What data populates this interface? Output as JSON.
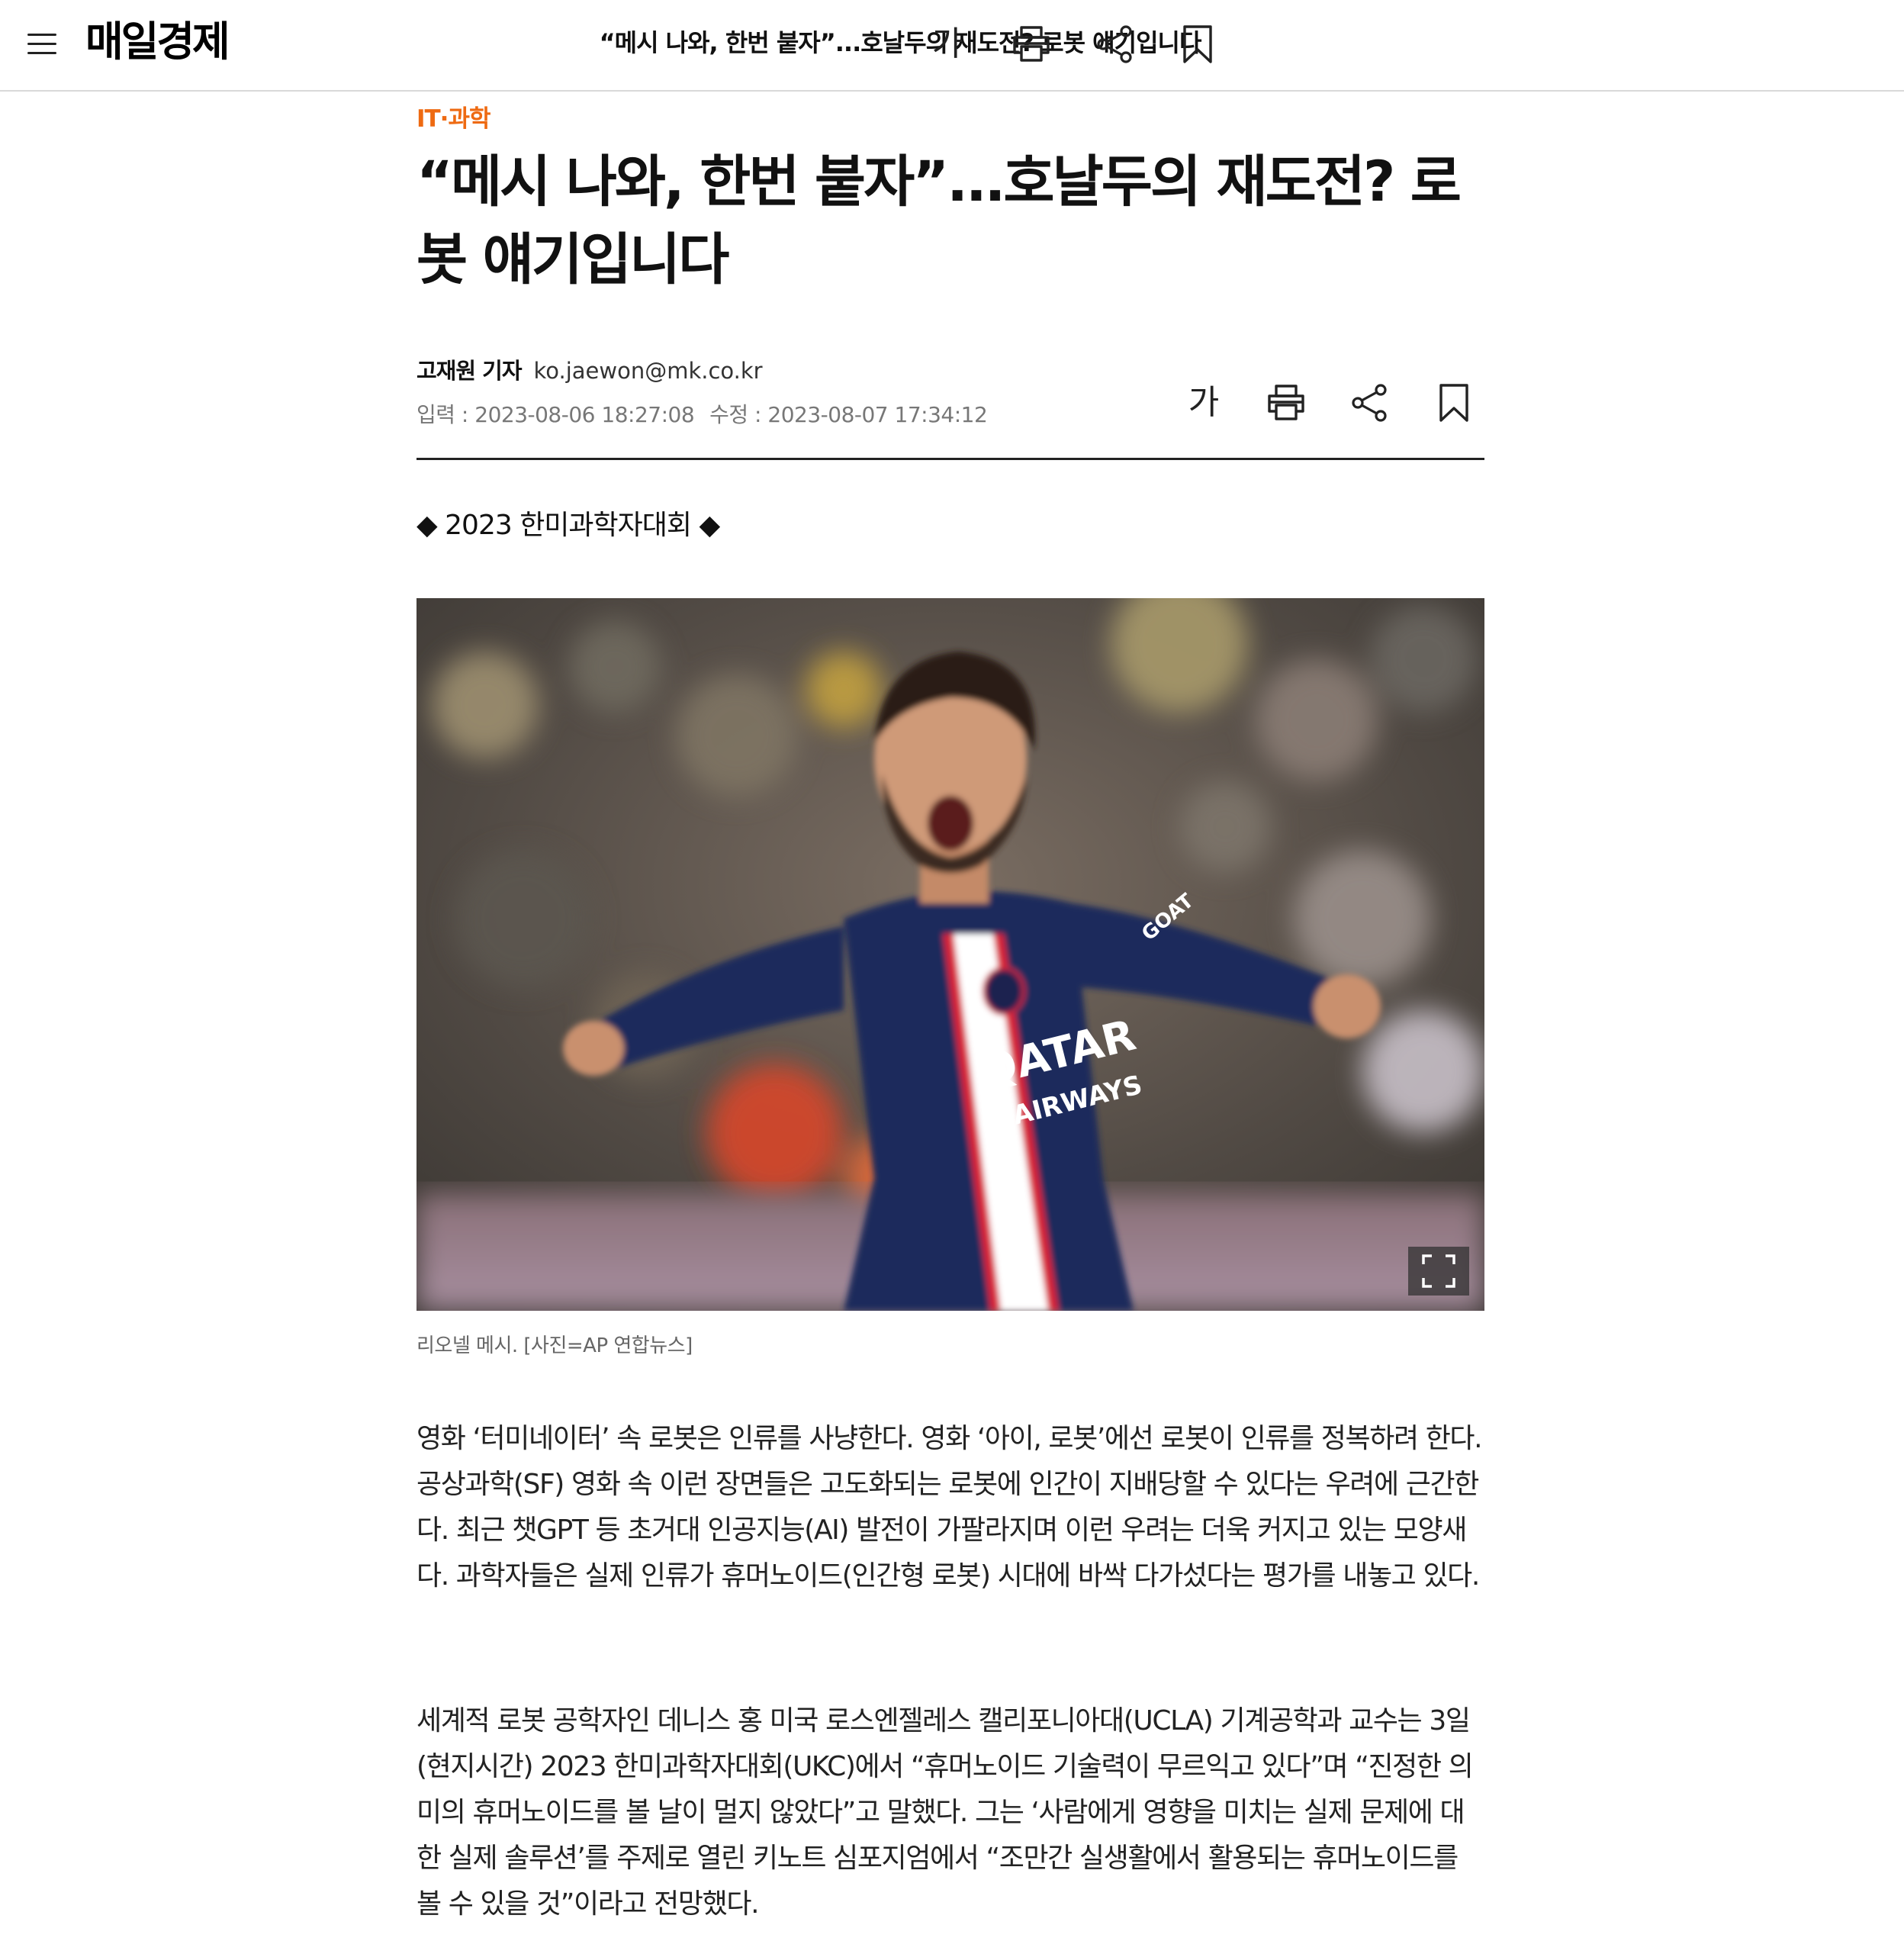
{
  "site": {
    "logo": "매일경제",
    "top_title": "“메시 나와, 한번 붙자”...호날두의 재도전? 로봇 얘기입니다",
    "font_size_glyph": "가"
  },
  "article": {
    "category": "IT·과학",
    "headline": "“메시 나와, 한번 붙자”...호날두의 재도전? 로봇 얘기입니다",
    "reporter": "고재원 기자",
    "email": "ko.jaewon@mk.co.kr",
    "input_date": "입력 : 2023-08-06 18:27:08",
    "modified_date": "수정 : 2023-08-07 17:34:12",
    "subhead": "◆ 2023 한미과학자대회 ◆",
    "photo_alt": "리오넬 메시",
    "jersey_text_1": "QATAR",
    "jersey_text_2": "AIRWAYS",
    "sleeve_text": "GOAT",
    "caption": "리오넬 메시. [사진=AP 연합뉴스]",
    "paragraphs": [
      "영화 ‘터미네이터’ 속 로봇은 인류를 사냥한다. 영화 ‘아이, 로봇’에선 로봇이 인류를 정복하려 한다. 공상과학(SF) 영화 속 이런 장면들은 고도화되는 로봇에 인간이 지배당할 수 있다는 우려에 근간한다. 최근 챗GPT 등 초거대 인공지능(AI) 발전이 가팔라지며 이런 우려는 더욱 커지고 있는 모양새다. 과학자들은 실제 인류가 휴머노이드(인간형 로봇) 시대에 바싹 다가섰다는 평가를 내놓고 있다.",
      "세계적 로봇 공학자인 데니스 홍 미국 로스엔젤레스 캘리포니아대(UCLA) 기계공학과 교수는 3일(현지시간) 2023 한미과학자대회(UKC)에서 “휴머노이드 기술력이 무르익고 있다”며 “진정한 의미의 휴머노이드를 볼 날이 멀지 않았다”고 말했다. 그는 ‘사람에게 영향을 미치는 실제 문제에 대한 실제 솔루션’를 주제로 열린 키노트 심포지엄에서 “조만간 실생활에서 활용되는 휴머노이드를 볼 수 있을 것”이라고 전망했다."
    ]
  },
  "colors": {
    "category": "#ee6a12",
    "jersey_navy": "#1f2a5c",
    "jersey_red": "#d7283a"
  },
  "icons": [
    "menu-icon",
    "font-size-icon",
    "print-icon",
    "share-icon",
    "bookmark-icon",
    "expand-icon"
  ]
}
